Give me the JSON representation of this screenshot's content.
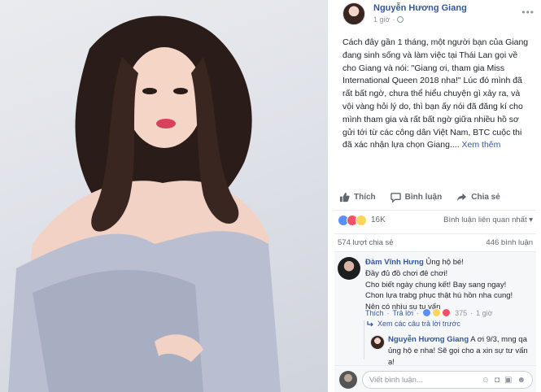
{
  "post": {
    "author": "Nguyễn Hương Giang",
    "time": "1 giờ",
    "text": "Cách đây gần 1 tháng, một người bạn của Giang đang sinh sống và làm việc tại Thái Lan gọi về cho Giang và nói: \"Giang ơi, tham gia Miss International Queen 2018 nha!\" Lúc đó mình đã rất bất ngờ, chưa thể hiểu chuyện gì xảy ra, và vội vàng hỏi lý do, thì bạn ấy nói đã đăng kí cho mình tham gia và rất bất ngờ giữa nhiều hồ sơ gửi tới từ các công dân Việt Nam, BTC cuộc thi đã xác nhận lựa chọn Giang....",
    "see_more": "Xem thêm",
    "menu_glyph": "•••"
  },
  "actions": {
    "like": "Thích",
    "comment": "Bình luận",
    "share": "Chia sẻ"
  },
  "reactions": {
    "count": "16K",
    "sort_label": "Bình luận liên quan nhất ▾",
    "types": [
      "like",
      "love",
      "wow"
    ]
  },
  "stats": {
    "shares": "574 lượt chia sẻ",
    "comments": "446 bình luận"
  },
  "comment1": {
    "author": "Đàm Vĩnh Hưng",
    "lines": [
      "Ủng hộ bé!",
      "Đầy đủ đồ chơi đê chơi!",
      "Cho biết ngày chung kết! Bay sang ngay!",
      "Chon lựa trabg phục thật hú hồn nha cung!",
      "Nên có nhìu sụ tu vấn"
    ],
    "like": "Thích",
    "reply": "Trả lời",
    "reaction_count": "375",
    "time": "1 giờ",
    "separator": "·"
  },
  "previous_replies": "Xem các câu trả lời trước",
  "reply1": {
    "author": "Nguyễn Hương Giang",
    "text": "A ơi 9/3, mng qa ủng hộ e nha! Sẽ gọi cho a xin sự tư vấn ạ!"
  },
  "composer": {
    "placeholder": "Viết bình luận..."
  },
  "colors": {
    "link_blue": "#365899",
    "like_blue": "#5890ff",
    "love_red": "#f25268",
    "wow_yellow": "#fcd55a"
  }
}
